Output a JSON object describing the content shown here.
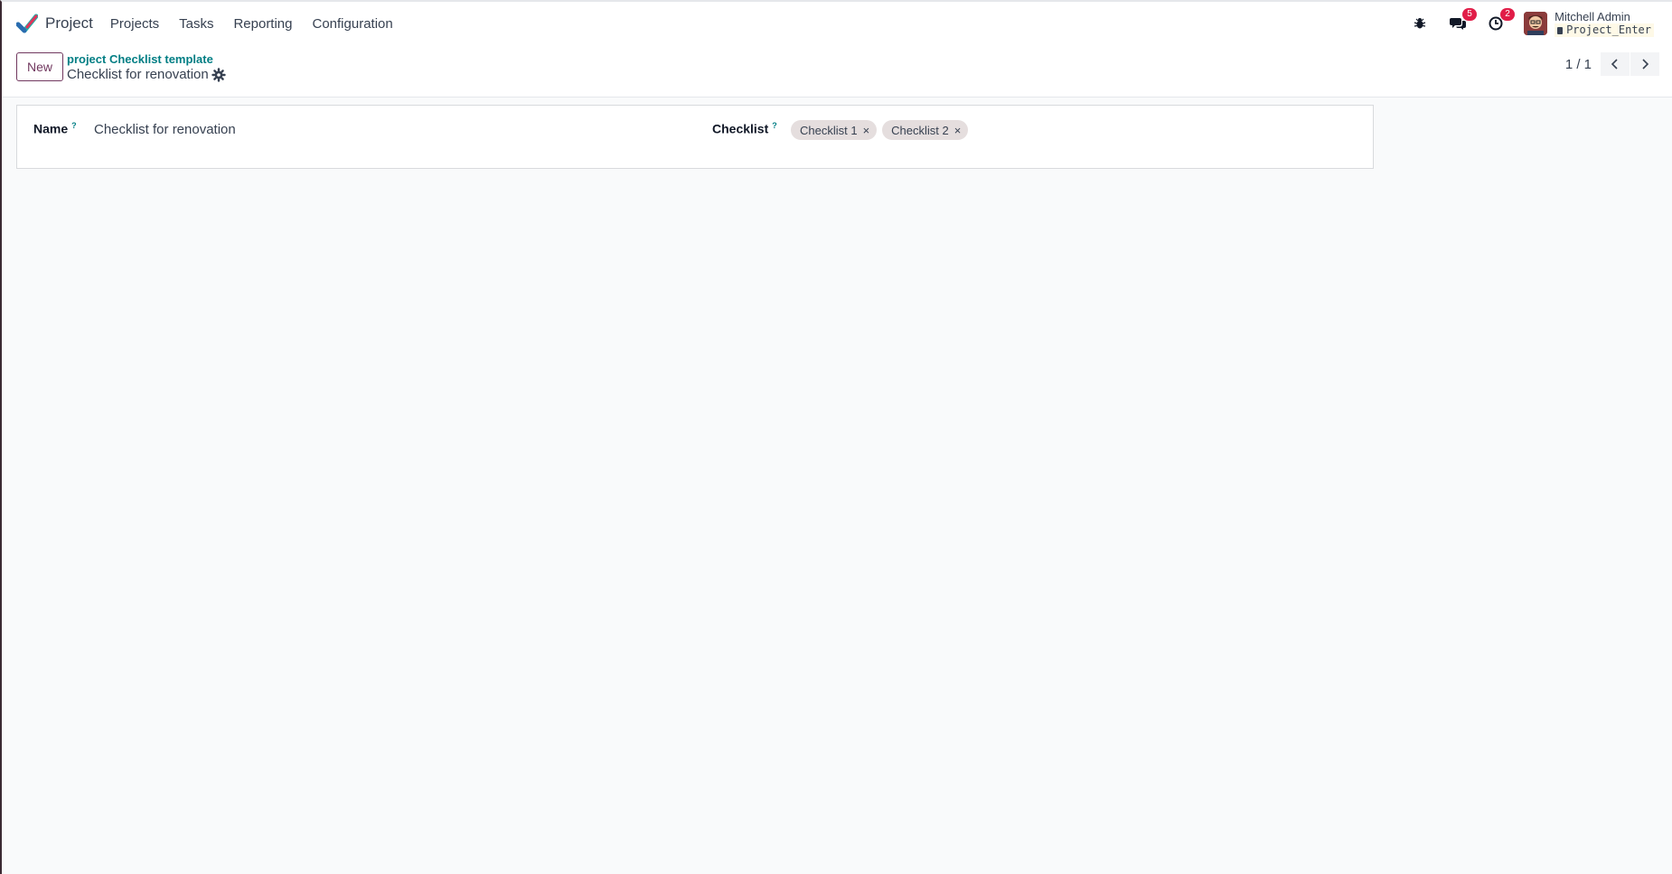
{
  "navbar": {
    "app_name": "Project",
    "menu": [
      "Projects",
      "Tasks",
      "Reporting",
      "Configuration"
    ],
    "systray": {
      "messages_count": "5",
      "activities_count": "2",
      "user_name": "Mitchell Admin",
      "database": "Project_Enter"
    },
    "icons": {
      "logo": "checkmark-logo-icon",
      "debug": "bug-icon",
      "messages": "chat-icon",
      "activities": "clock-icon"
    }
  },
  "control_panel": {
    "new_label": "New",
    "breadcrumb": "project Checklist template",
    "record_title": "Checklist for renovation",
    "pager": "1 / 1"
  },
  "form": {
    "name_label": "Name",
    "name_help": "?",
    "name_value": "Checklist for renovation",
    "checklist_label": "Checklist",
    "checklist_help": "?",
    "checklist_tags": [
      "Checklist 1",
      "Checklist 2"
    ],
    "tag_remove_symbol": "×"
  },
  "colors": {
    "brand": "#71385f",
    "link": "#017e84",
    "badge": "#e11d48",
    "background": "#f9fafb"
  }
}
